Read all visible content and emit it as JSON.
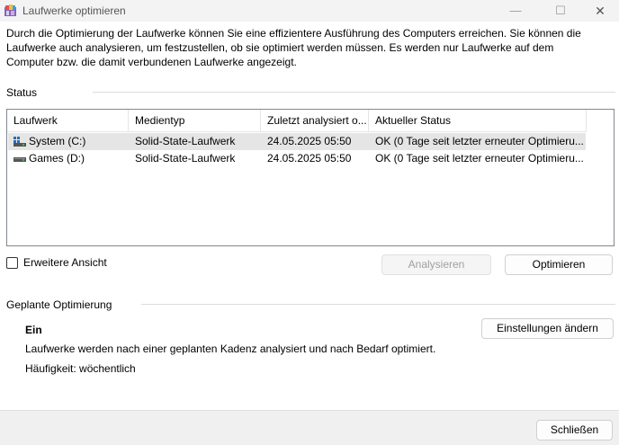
{
  "window": {
    "title": "Laufwerke optimieren",
    "minimize_icon": "—",
    "maximize_icon": "☐",
    "close_icon": "✕"
  },
  "intro": "Durch die Optimierung der Laufwerke können Sie eine effizientere Ausführung des Computers erreichen. Sie können die Laufwerke auch analysieren, um festzustellen, ob sie optimiert werden müssen. Es werden nur Laufwerke auf dem Computer bzw. die damit verbundenen Laufwerke angezeigt.",
  "status": {
    "label": "Status",
    "columns": [
      "Laufwerk",
      "Medientyp",
      "Zuletzt analysiert o...",
      "Aktueller Status"
    ],
    "drives": [
      {
        "name": "System (C:)",
        "icon": "system-drive-icon",
        "media_type": "Solid-State-Laufwerk",
        "last_analyzed": "24.05.2025 05:50",
        "current_status": "OK (0 Tage seit letzter erneuter Optimieru...",
        "selected": true
      },
      {
        "name": "Games (D:)",
        "icon": "drive-icon",
        "media_type": "Solid-State-Laufwerk",
        "last_analyzed": "24.05.2025 05:50",
        "current_status": "OK (0 Tage seit letzter erneuter Optimieru...",
        "selected": false
      }
    ],
    "advanced_view_label": "Erweitere Ansicht",
    "advanced_view_checked": false,
    "analyze_label": "Analysieren",
    "optimize_label": "Optimieren"
  },
  "scheduled": {
    "label": "Geplante Optimierung",
    "state": "Ein",
    "description": "Laufwerke werden nach einer geplanten Kadenz analysiert und nach Bedarf optimiert.",
    "frequency": "Häufigkeit: wöchentlich",
    "change_settings_label": "Einstellungen ändern"
  },
  "footer": {
    "close_label": "Schließen"
  },
  "colors": {
    "selected_row": "#e5e5e5",
    "window_bg": "#f0f0f0",
    "content_bg": "#ffffff",
    "drive_icon_blue": "#2b6cb0"
  }
}
